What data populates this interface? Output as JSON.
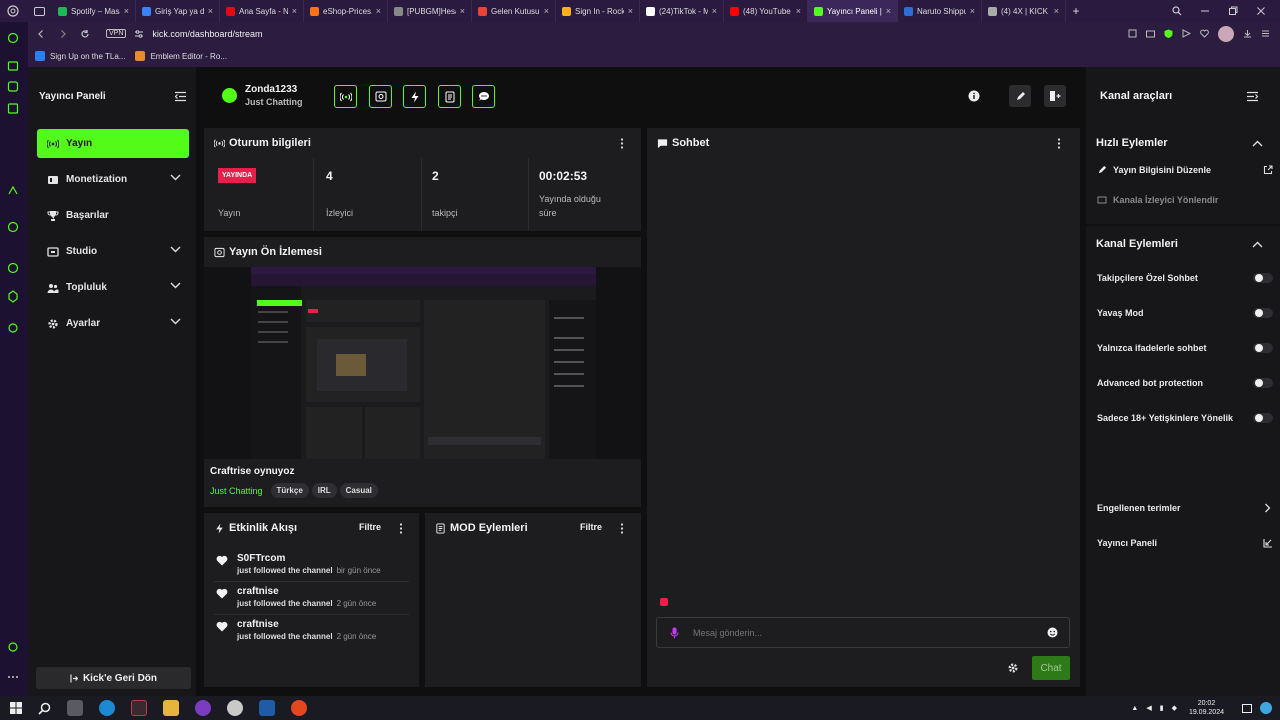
{
  "browser": {
    "tabs": [
      {
        "label": "Spotify – Masa",
        "color": "#1db954"
      },
      {
        "label": "Giriş Yap ya da",
        "color": "#3b82f6"
      },
      {
        "label": "Ana Sayfa - Ne",
        "color": "#e50914"
      },
      {
        "label": "eShop-Prices.c",
        "color": "#f97316"
      },
      {
        "label": "[PUBGM]Hesap",
        "color": "#888888"
      },
      {
        "label": "Gelen Kutusu (",
        "color": "#ea4335"
      },
      {
        "label": "Sign In - Rocks",
        "color": "#fcaf17"
      },
      {
        "label": "(24)TikTok - Ma",
        "color": "#ffffff"
      },
      {
        "label": "(48) YouTube",
        "color": "#ff0000"
      },
      {
        "label": "Yayıncı Paneli |",
        "color": "#53fc18"
      },
      {
        "label": "Naruto Shippu",
        "color": "#2f6cd8"
      },
      {
        "label": "(4) 4X | KICK",
        "color": "#aaaaaa"
      }
    ],
    "active_tab": 9,
    "url": "kick.com/dashboard/stream",
    "vpn": "VPN",
    "bookmarks": [
      {
        "label": "Sign Up on the TLa...",
        "color": "#2d7ef7"
      },
      {
        "label": "Emblem Editor - Ro...",
        "color": "#e8892c"
      }
    ]
  },
  "sidebar": {
    "title": "Yayıncı Paneli",
    "items": [
      {
        "label": "Yayın",
        "icon": "broadcast-icon",
        "chevron": false
      },
      {
        "label": "Monetization",
        "icon": "wallet-icon",
        "chevron": true
      },
      {
        "label": "Başarılar",
        "icon": "trophy-icon",
        "chevron": false
      },
      {
        "label": "Studio",
        "icon": "studio-icon",
        "chevron": true
      },
      {
        "label": "Topluluk",
        "icon": "community-icon",
        "chevron": true
      },
      {
        "label": "Ayarlar",
        "icon": "gear-icon",
        "chevron": true
      }
    ],
    "back_button": "Kick'e Geri Dön"
  },
  "channel": {
    "name": "Zonda1233",
    "category": "Just Chatting"
  },
  "session": {
    "title": "Oturum bilgileri",
    "live_badge": "YAYINDA",
    "status_label": "Yayın",
    "viewers": "4",
    "viewers_label": "İzleyici",
    "followers": "2",
    "followers_label": "takipçi",
    "uptime": "00:02:53",
    "uptime_label_1": "Yayında olduğu",
    "uptime_label_2": "süre"
  },
  "preview": {
    "title": "Yayın Ön İzlemesi",
    "stream_title": "Craftrise oynuyoz",
    "category": "Just Chatting",
    "tags": [
      "Türkçe",
      "IRL",
      "Casual"
    ]
  },
  "activity": {
    "title": "Etkinlik Akışı",
    "filter": "Filtre",
    "items": [
      {
        "name": "S0FTrcom",
        "action": "just followed the channel",
        "time": "bir gün önce"
      },
      {
        "name": "craftnise",
        "action": "just followed the channel",
        "time": "2 gün önce"
      },
      {
        "name": "craftnise",
        "action": "just followed the channel",
        "time": "2 gün önce"
      }
    ]
  },
  "mod": {
    "title": "MOD Eylemleri",
    "filter": "Filtre"
  },
  "chat": {
    "title": "Sohbet",
    "placeholder": "Mesaj gönderin...",
    "send": "Chat"
  },
  "right": {
    "title": "Kanal araçları",
    "quick_title": "Hızlı Eylemler",
    "quick": [
      "Yayın Bilgisini Düzenle",
      "Kanala İzleyici Yönlendir"
    ],
    "channel_title": "Kanal Eylemleri",
    "toggles": [
      "Takipçilere Özel Sohbet",
      "Yavaş Mod",
      "Yalnızca ifadelerle sohbet",
      "Advanced bot protection",
      "Sadece 18+ Yetişkinlere Yönelik"
    ],
    "links": [
      "Engellenen terimler",
      "Yayıncı Paneli"
    ]
  },
  "taskbar": {
    "time": "20:02",
    "date": "19.09.2024"
  },
  "colors": {
    "accent": "#53fc18",
    "live": "#e91e4a",
    "panel": "#1d1d1f"
  }
}
